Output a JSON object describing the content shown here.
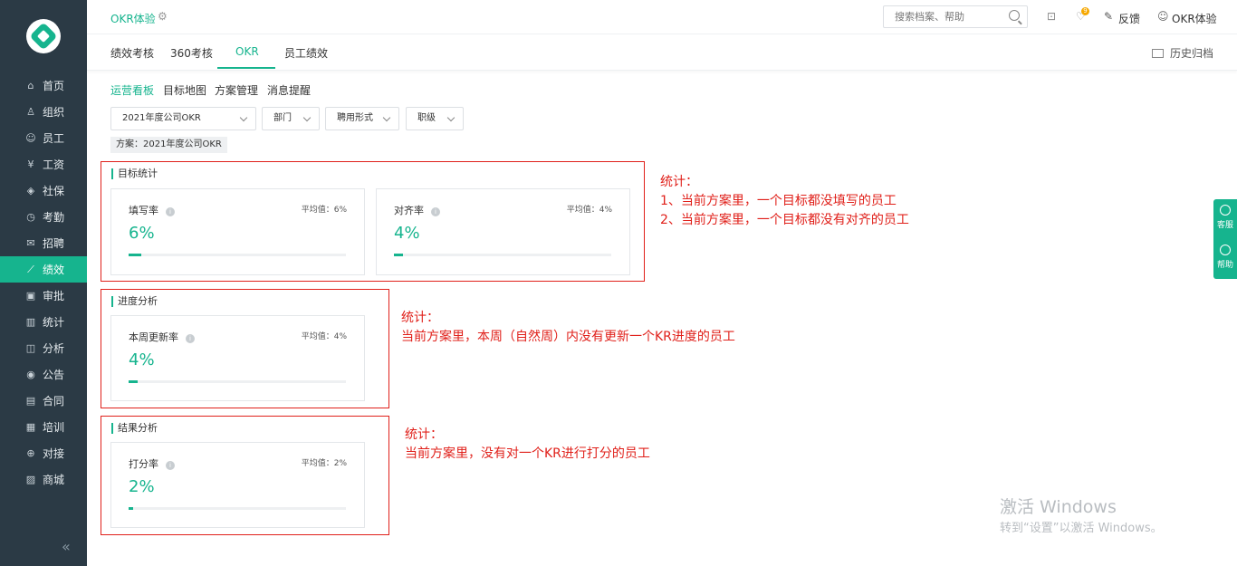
{
  "sidebar": {
    "items": [
      {
        "label": "首页",
        "icon": "home-icon",
        "glyph": "⌂"
      },
      {
        "label": "组织",
        "icon": "org-icon",
        "glyph": "♙"
      },
      {
        "label": "员工",
        "icon": "employee-icon",
        "glyph": "☺"
      },
      {
        "label": "工资",
        "icon": "salary-icon",
        "glyph": "¥"
      },
      {
        "label": "社保",
        "icon": "shield-icon",
        "glyph": "◈"
      },
      {
        "label": "考勤",
        "icon": "attendance-icon",
        "glyph": "◷"
      },
      {
        "label": "招聘",
        "icon": "recruit-icon",
        "glyph": "✉"
      },
      {
        "label": "绩效",
        "icon": "performance-icon",
        "glyph": "⟋"
      },
      {
        "label": "审批",
        "icon": "approval-icon",
        "glyph": "▣"
      },
      {
        "label": "统计",
        "icon": "statistics-icon",
        "glyph": "▥"
      },
      {
        "label": "分析",
        "icon": "analysis-icon",
        "glyph": "◫"
      },
      {
        "label": "公告",
        "icon": "announcement-icon",
        "glyph": "◉"
      },
      {
        "label": "合同",
        "icon": "contract-icon",
        "glyph": "▤"
      },
      {
        "label": "培训",
        "icon": "training-icon",
        "glyph": "▦"
      },
      {
        "label": "对接",
        "icon": "integration-icon",
        "glyph": "⊕"
      },
      {
        "label": "商城",
        "icon": "mall-icon",
        "glyph": "▨"
      }
    ],
    "active_index": 7,
    "collapse_glyph": "«"
  },
  "header": {
    "app_title": "OKR体验",
    "settings_glyph": "⚙",
    "search_placeholder": "搜索档案、帮助",
    "bookmark_glyph": "⊡",
    "notify_glyph": "♡",
    "badge_count": "9",
    "feedback_glyph": "✎",
    "feedback_label": "反馈",
    "user_glyph": "☺",
    "user_label": "OKR体验"
  },
  "tabs": {
    "items": [
      "绩效考核",
      "360考核",
      "OKR",
      "员工绩效"
    ],
    "active": "OKR",
    "history_label": "历史归档"
  },
  "subtabs": {
    "items": [
      "运营看板",
      "目标地图",
      "方案管理",
      "消息提醒"
    ],
    "active": "运营看板"
  },
  "filters": {
    "plan_select": "2021年度公司OKR",
    "department": "部门",
    "employment": "聘用形式",
    "rank": "职级",
    "plan_tag": "方案：2021年度公司OKR"
  },
  "sections": {
    "goal": {
      "title": "目标统计",
      "cards": [
        {
          "label": "填写率",
          "avg": "平均值：6%",
          "value": "6%",
          "fill": 0.06
        },
        {
          "label": "对齐率",
          "avg": "平均值：4%",
          "value": "4%",
          "fill": 0.04
        }
      ]
    },
    "progress": {
      "title": "进度分析",
      "cards": [
        {
          "label": "本周更新率",
          "avg": "平均值：4%",
          "value": "4%",
          "fill": 0.04
        }
      ]
    },
    "result": {
      "title": "结果分析",
      "cards": [
        {
          "label": "打分率",
          "avg": "平均值：2%",
          "value": "2%",
          "fill": 0.02
        }
      ]
    },
    "info_glyph": "i"
  },
  "annotations": {
    "goal": [
      "统计：",
      "1、当前方案里，一个目标都没填写的员工",
      "2、当前方案里，一个目标都没有对齐的员工"
    ],
    "progress": [
      "统计：",
      "当前方案里，本周（自然周）内没有更新一个KR进度的员工"
    ],
    "result": [
      "统计：",
      "当前方案里，没有对一个KR进行打分的员工"
    ]
  },
  "float_widget": {
    "service": "客服",
    "help": "帮助"
  },
  "watermark": {
    "line1": "激活 Windows",
    "line2": "转到“设置”以激活 Windows。"
  },
  "colors": {
    "accent": "#16b48e",
    "sidebar": "#2b3a45",
    "annotation": "#e0201a"
  }
}
